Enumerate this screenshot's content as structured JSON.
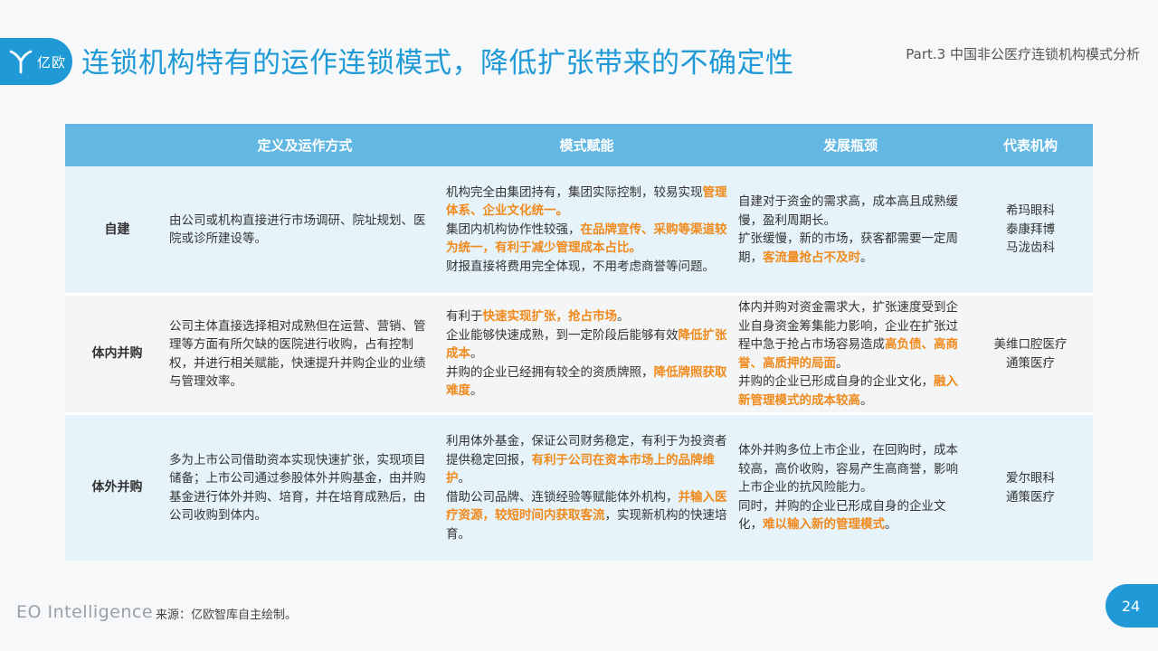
{
  "header": {
    "logo_text": "亿欧",
    "title": "连锁机构特有的运作连锁模式，降低扩张带来的不确定性",
    "part_label": "Part.3 中国非公医疗连锁机构模式分析"
  },
  "colors": {
    "accent": "#1f9ad6",
    "table_header": "#62b8e3",
    "highlight": "#f08a1c"
  },
  "icons": {
    "logo": "yiou-logo-icon"
  },
  "table": {
    "headers": [
      "",
      "定义及运作方式",
      "模式赋能",
      "发展瓶颈",
      "代表机构"
    ],
    "rows": [
      {
        "category": "自建",
        "definition": "由公司或机构直接进行市场调研、院址规划、医院或诊所建设等。",
        "empowerment": [
          [
            {
              "t": "机构完全由集团持有，集团实际控制，较易实现"
            },
            {
              "t": "管理体系、企业文化统一。",
              "h": true
            }
          ],
          [
            {
              "t": "集团内机构协作性较强，"
            },
            {
              "t": "在品牌宣传、采购等渠道较为统一，有利于减少管理成本占比。",
              "h": true
            }
          ],
          [
            {
              "t": "财报直接将费用完全体现，不用考虑商誉等问题。"
            }
          ]
        ],
        "bottleneck": [
          [
            {
              "t": "自建对于资金的需求高，成本高且成熟缓慢，盈利周期长。"
            }
          ],
          [
            {
              "t": "扩张缓慢，新的市场，获客都需要一定周期，"
            },
            {
              "t": "客流量抢占不及时",
              "h": true
            },
            {
              "t": "。"
            }
          ]
        ],
        "institutions": [
          "希玛眼科",
          "泰康拜博",
          "马泷齿科"
        ]
      },
      {
        "category": "体内并购",
        "definition": "公司主体直接选择相对成熟但在运营、营销、管理等方面有所欠缺的医院进行收购，占有控制权，并进行相关赋能，快速提升并购企业的业绩与管理效率。",
        "empowerment": [
          [
            {
              "t": "有利于"
            },
            {
              "t": "快速实现扩张，抢占市场",
              "h": true
            },
            {
              "t": "。"
            }
          ],
          [
            {
              "t": "企业能够快速成熟，到一定阶段后能够有效"
            },
            {
              "t": "降低扩张成本",
              "h": true
            },
            {
              "t": "。"
            }
          ],
          [
            {
              "t": "并购的企业已经拥有较全的资质牌照，"
            },
            {
              "t": "降低牌照获取难度",
              "h": true
            },
            {
              "t": "。"
            }
          ]
        ],
        "bottleneck": [
          [
            {
              "t": "体内并购对资金需求大，扩张速度受到企业自身资金筹集能力影响，企业在扩张过程中急于抢占市场容易造成"
            },
            {
              "t": "高负债、高商誉、高质押的局面",
              "h": true
            },
            {
              "t": "。"
            }
          ],
          [
            {
              "t": "并购的企业已形成自身的企业文化，"
            },
            {
              "t": "融入新管理模式的成本较高",
              "h": true
            },
            {
              "t": "。"
            }
          ]
        ],
        "institutions": [
          "美维口腔医疗",
          "通策医疗"
        ]
      },
      {
        "category": "体外并购",
        "definition": "多为上市公司借助资本实现快速扩张，实现项目储备；上市公司通过参股体外并购基金，由并购基金进行体外并购、培育，并在培育成熟后，由公司收购到体内。",
        "empowerment": [
          [
            {
              "t": "利用体外基金，保证公司财务稳定，有利于为投资者提供稳定回报，"
            },
            {
              "t": "有利于公司在资本市场上的品牌维护",
              "h": true
            },
            {
              "t": "。"
            }
          ],
          [
            {
              "t": "借助公司品牌、连锁经验等赋能体外机构，"
            },
            {
              "t": "并输入医疗资源，较短时间内获取客流",
              "h": true
            },
            {
              "t": "，实现新机构的快速培育。"
            }
          ]
        ],
        "bottleneck": [
          [
            {
              "t": "体外并购多位上市企业，在回购时，成本较高，高价收购，容易产生高商誉，影响上市企业的抗风险能力。"
            }
          ],
          [
            {
              "t": "同时，并购的企业已形成自身的企业文化，"
            },
            {
              "t": "难以输入新的管理模式",
              "h": true
            },
            {
              "t": "。"
            }
          ]
        ],
        "institutions": [
          "爱尔眼科",
          "通策医疗"
        ]
      }
    ]
  },
  "footer": {
    "brand": "EO Intelligence",
    "source": "来源：亿欧智库自主绘制。",
    "page_number": "24"
  }
}
